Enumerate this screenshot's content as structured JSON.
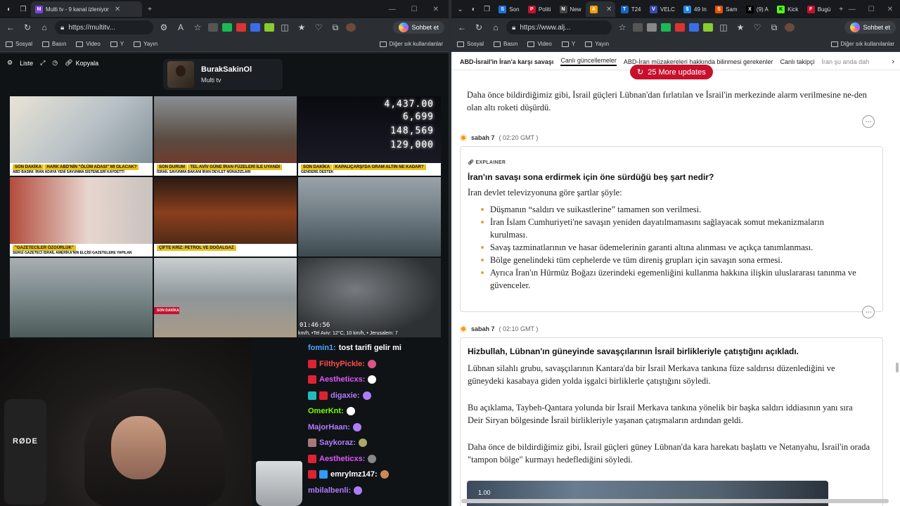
{
  "left_browser": {
    "tab_active": "Multi tv - 9 kanal izleniyor",
    "url": "https://multitv...",
    "chat_button": "Sohbet et",
    "bookmarks": [
      "Sosyal",
      "Basın",
      "Video",
      "Y",
      "Yayın"
    ],
    "bookmarks_right": "Diğer sık kullanılanlar"
  },
  "multi": {
    "toolbar": {
      "list": "Liste",
      "copy": "Kopyala"
    },
    "channel_name": "BurakSakinOl",
    "channel_sub": "Multi tv",
    "cells": [
      {
        "tag": "SON DAKİKA",
        "headline": "HARK ABD'NİN \"ÖLÜM ADASI\" MI OLACAK?",
        "sub": "ABD BASINI: İRAN ADAYA YENİ SAVUNMA SİSTEMLERİ KAYDETTİ"
      },
      {
        "tag": "SON DURUM",
        "headline": "TEL AVİV GÜNE İRAN FÜZELERİ İLE UYANDI",
        "sub": "İSRAİL SAVUNMA BAKANI İRAN DEVLET MÜNAZIZLARI"
      },
      {
        "tag": "SON DAKİKA",
        "headline": "KAPALIÇARŞI'DA GRAM ALTIN NE KADAR?",
        "sub": "GENDERE DESTEK",
        "stocks": [
          "4,437.00",
          "6,699",
          "148,569",
          "129,000"
        ]
      },
      {
        "tag": "",
        "headline": "\"GAZETECİLER ÖZGÜRLÜK\"",
        "sub": "SERGİ GAZETECİ İSRAİL AMERİKA'NIN ELÇİSİ GAZETELERE YAPILAN"
      },
      {
        "tag": "",
        "headline": "ÇİFTE KRİZ: PETROL VE DOĞALGAZ",
        "sub": ""
      },
      {
        "tag": "",
        "headline": "",
        "sub": ""
      },
      {
        "tag": "",
        "headline": "",
        "sub": ""
      },
      {
        "tag": "SON DAKİKA",
        "headline": "",
        "sub": ""
      },
      {
        "tag": "",
        "headline": "",
        "sub": "",
        "time": "01:46:56",
        "weather": "km/h, •Tel Aviv: 12°C, 10 km/h, • Jerusalem: 7"
      }
    ]
  },
  "webcam": {
    "mic_brand": "RØDE"
  },
  "chat": [
    {
      "user": "fomin1:",
      "msg": "tost tarifi gelir mi",
      "color": "#4da6ff"
    },
    {
      "user": "FilthyPickle:",
      "msg": "",
      "color": "#ff4d4d"
    },
    {
      "user": "Aestheticxs:",
      "msg": "",
      "color": "#e056fd"
    },
    {
      "user": "digaxie:",
      "msg": "",
      "color": "#b07cff"
    },
    {
      "user": "OmerKnt:",
      "msg": "",
      "color": "#7cfc00"
    },
    {
      "user": "MajorHaan:",
      "msg": "",
      "color": "#b07cff"
    },
    {
      "user": "Saykoraz:",
      "msg": "",
      "color": "#b07cff"
    },
    {
      "user": "Aestheticxs:",
      "msg": "",
      "color": "#e056fd"
    },
    {
      "user": "emrylmz147:",
      "msg": "",
      "color": "#ffffff"
    },
    {
      "user": "mbilalbenli:",
      "msg": "",
      "color": "#b07cff"
    }
  ],
  "right_browser": {
    "tabs": [
      "Son",
      "Politi",
      "New",
      "",
      "T24",
      "VELC",
      "49 In",
      "Sam",
      "(9) A",
      "Kick",
      "Bugü"
    ],
    "url": "https://www.alj...",
    "chat_button": "Sohbet et",
    "bookmarks": [
      "Sosyal",
      "Basın",
      "Video",
      "Y",
      "Yayın"
    ],
    "bookmarks_right": "Diğer sık kullanılanlar"
  },
  "article": {
    "nav": [
      "ABD-İsrail'in İran'a karşı savaşı",
      "Canlı güncellemeler",
      "ABD-İran müzakereleri hakkında bilinmesi gerekenler",
      "Canlı takipçi",
      "İran şu anda dah"
    ],
    "more_updates": "25 More updates",
    "para_top": "Daha önce bildirdiğimiz gibi, İsrail güçleri Lübnan'dan fırlatılan ve İsrail'in merkezinde alarm verilmesine ne-den olan altı roketi düşürdü.",
    "entry1": {
      "label": "sabah 7",
      "time": "( 02:20 GMT )",
      "tag": "EXPLAINER",
      "title": "İran'ın savaşı sona erdirmek için öne sürdüğü beş şart nedir?",
      "intro": "İran devlet televizyonuna göre şartlar şöyle:",
      "bullets": [
        "Düşmanın “saldırı ve suikastlerine” tamamen son verilmesi.",
        "İran İslam Cumhuriyeti'ne savaşın yeniden dayatılmamasını sağlayacak somut mekanizmaların kurulması.",
        "Savaş tazminatlarının ve hasar ödemelerinin garanti altına alınması ve açıkça tanımlanması.",
        "Bölge genelindeki tüm cephelerde ve tüm direniş grupları için savaşın sona ermesi.",
        "Ayrıca İran'ın Hürmüz Boğazı üzerindeki egemenliğini kullanma hakkına ilişkin uluslararası tanınma ve güvenceler."
      ]
    },
    "entry2": {
      "label": "sabah 7",
      "time": "( 02:10 GMT )",
      "title": "Hizbullah, Lübnan'ın güneyinde savaşçılarının İsrail birlikleriyle çatıştığını açıkladı.",
      "p1": "Lübnan silahlı grubu, savaşçılarının Kantara'da bir İsrail Merkava tankına füze saldırısı düzenlediğini ve güneydeki kasabaya giden yolda işgalci birliklerle çatıştığını söyledi.",
      "p2": "Bu açıklama, Taybeh-Qantara yolunda bir İsrail Merkava tankına yönelik bir başka saldırı iddiasının yanı sıra Deir Siryan bölgesinde İsrail birlikleriyle yaşanan çatışmaların ardından geldi.",
      "p3": "Daha önce de bildirdiğimiz gibi, İsrail güçleri güney Lübnan'da kara harekatı başlattı ve Netanyahu, İsrail'in orada \"tampon bölge\" kurmayı hedeflediğini söyledi.",
      "video_time": "1.00"
    }
  }
}
